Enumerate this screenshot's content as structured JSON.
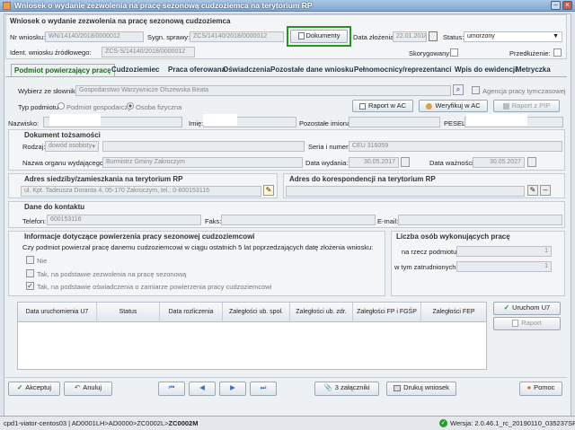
{
  "window": {
    "title": "Wniosek o wydanie zezwolenia na pracę sezonową cudzoziemca na terytorium RP"
  },
  "header": {
    "group_title": "Wniosek o wydanie zezwolenia na pracę sezonową cudzoziemca",
    "nr_label": "Nr wniosku:",
    "nr_value": "WN/14140/2018/0000012",
    "sygn_label": "Sygn. sprawy:",
    "sygn_value": "ZCS/14140/2018/0000012",
    "documents_button": "Dokumenty",
    "date_label": "Data złożenia:",
    "date_value": "22.01.2018",
    "status_label": "Status:",
    "status_value": "umorzony",
    "ident_label": "Ident. wniosku źródłowego:",
    "ident_value": "ZCS-S/14140/2018/0000012",
    "skoryg_label": "Skorygowany:",
    "przed_label": "Przedłużenie:"
  },
  "tabs": [
    "Podmiot powierzający pracę",
    "Cudzoziemiec",
    "Praca oferowana",
    "Oświadczenia",
    "Pozostałe dane wniosku",
    "Pełnomocnicy/reprezentanci",
    "Wpis do ewidencji",
    "Metryczka"
  ],
  "podmiot": {
    "slownik_label": "Wybierz ze słownika:",
    "slownik_value": "Gospodarstwo Warzywnicze Olszewska Beata",
    "agencja_label": "Agencja pracy tymczasowej",
    "typ_label": "Typ podmiotu",
    "opt1": "Podmiot gospodarczy",
    "opt2": "Osoba fizyczna",
    "raport_ac": "Raport w AC",
    "weryfikuj_ac": "Weryfikuj w AC",
    "raport_pip": "Raport z PIP",
    "nazwisko_label": "Nazwisko:",
    "imie_label": "Imię:",
    "pozostale_label": "Pozostałe imiona:",
    "pesel_label": "PESEL:"
  },
  "dokument": {
    "title": "Dokument tożsamości",
    "rodzaj_label": "Rodzaj:",
    "rodzaj_value": "dowód osobisty",
    "seria_label": "Seria i numer:",
    "seria_value": "CEU 316059",
    "organ_label": "Nazwa organu wydającego:",
    "organ_value": "Burmistrz Gminy Zakroczym",
    "data_wyd_label": "Data wydania:",
    "data_wyd_value": "30.05.2017",
    "data_waz_label": "Data ważności:",
    "data_waz_value": "30.05.2027"
  },
  "adres": {
    "title": "Adres siedziby/zamieszkania na terytorium RP",
    "value": "ul. Kpt. Tadeusza Doranta 4, 05-170 Zakroczym, tel.: 0-600153116",
    "koresp_title": "Adres do korespondencji na terytorium RP"
  },
  "kontakt": {
    "title": "Dane do kontaktu",
    "tel_label": "Telefon:",
    "tel_value": "600153116",
    "faks_label": "Faks:",
    "email_label": "E-mail:"
  },
  "info": {
    "title": "Informacje dotyczące powierzenia pracy sezonowej cudzoziemcowi",
    "question": "Czy podmiot powierzał pracę danemu cudzoziemcowi w ciągu ostatnich 5 lat poprzedzających datę złożenia wniosku:",
    "opt_nie": "Nie",
    "opt_zezw": "Tak, na podstawie zezwolenia na pracę sezonową",
    "opt_osw": "Tak, na podstawie oświadczenia o zamiarze powierzenia pracy cudzoziemcowi"
  },
  "liczba": {
    "title": "Liczba osób wykonujących pracę",
    "rzecz_label": "na rzecz podmiotu:",
    "rzecz_value": "1",
    "zatr_label": "w tym zatrudnionych:",
    "zatr_value": "1"
  },
  "table": {
    "headers": [
      "Data uruchomienia U7",
      "Status",
      "Data rozliczenia",
      "Zaległości ub. społ.",
      "Zaległości ub. zdr.",
      "Zaległości FP i FGŚP",
      "Zaległości FEP"
    ],
    "uruchom": "Uruchom U7",
    "raport": "Raport"
  },
  "footer": {
    "akceptuj": "Akceptuj",
    "anuluj": "Anuluj",
    "zalaczniki": "3 załączniki",
    "drukuj": "Drukuj wniosek",
    "pomoc": "Pomoc"
  },
  "statusbar": {
    "path": "cpd1-viator-centos03 | AD0001LH>AD0000>ZC0002L>",
    "path_bold": "ZC0002M",
    "version": "Wersja: 2.0.46.1_rc_20190110_035237SRC"
  },
  "colors": {
    "accent_green": "#1a8a1a",
    "highlight_border": "#1d9a1d"
  }
}
